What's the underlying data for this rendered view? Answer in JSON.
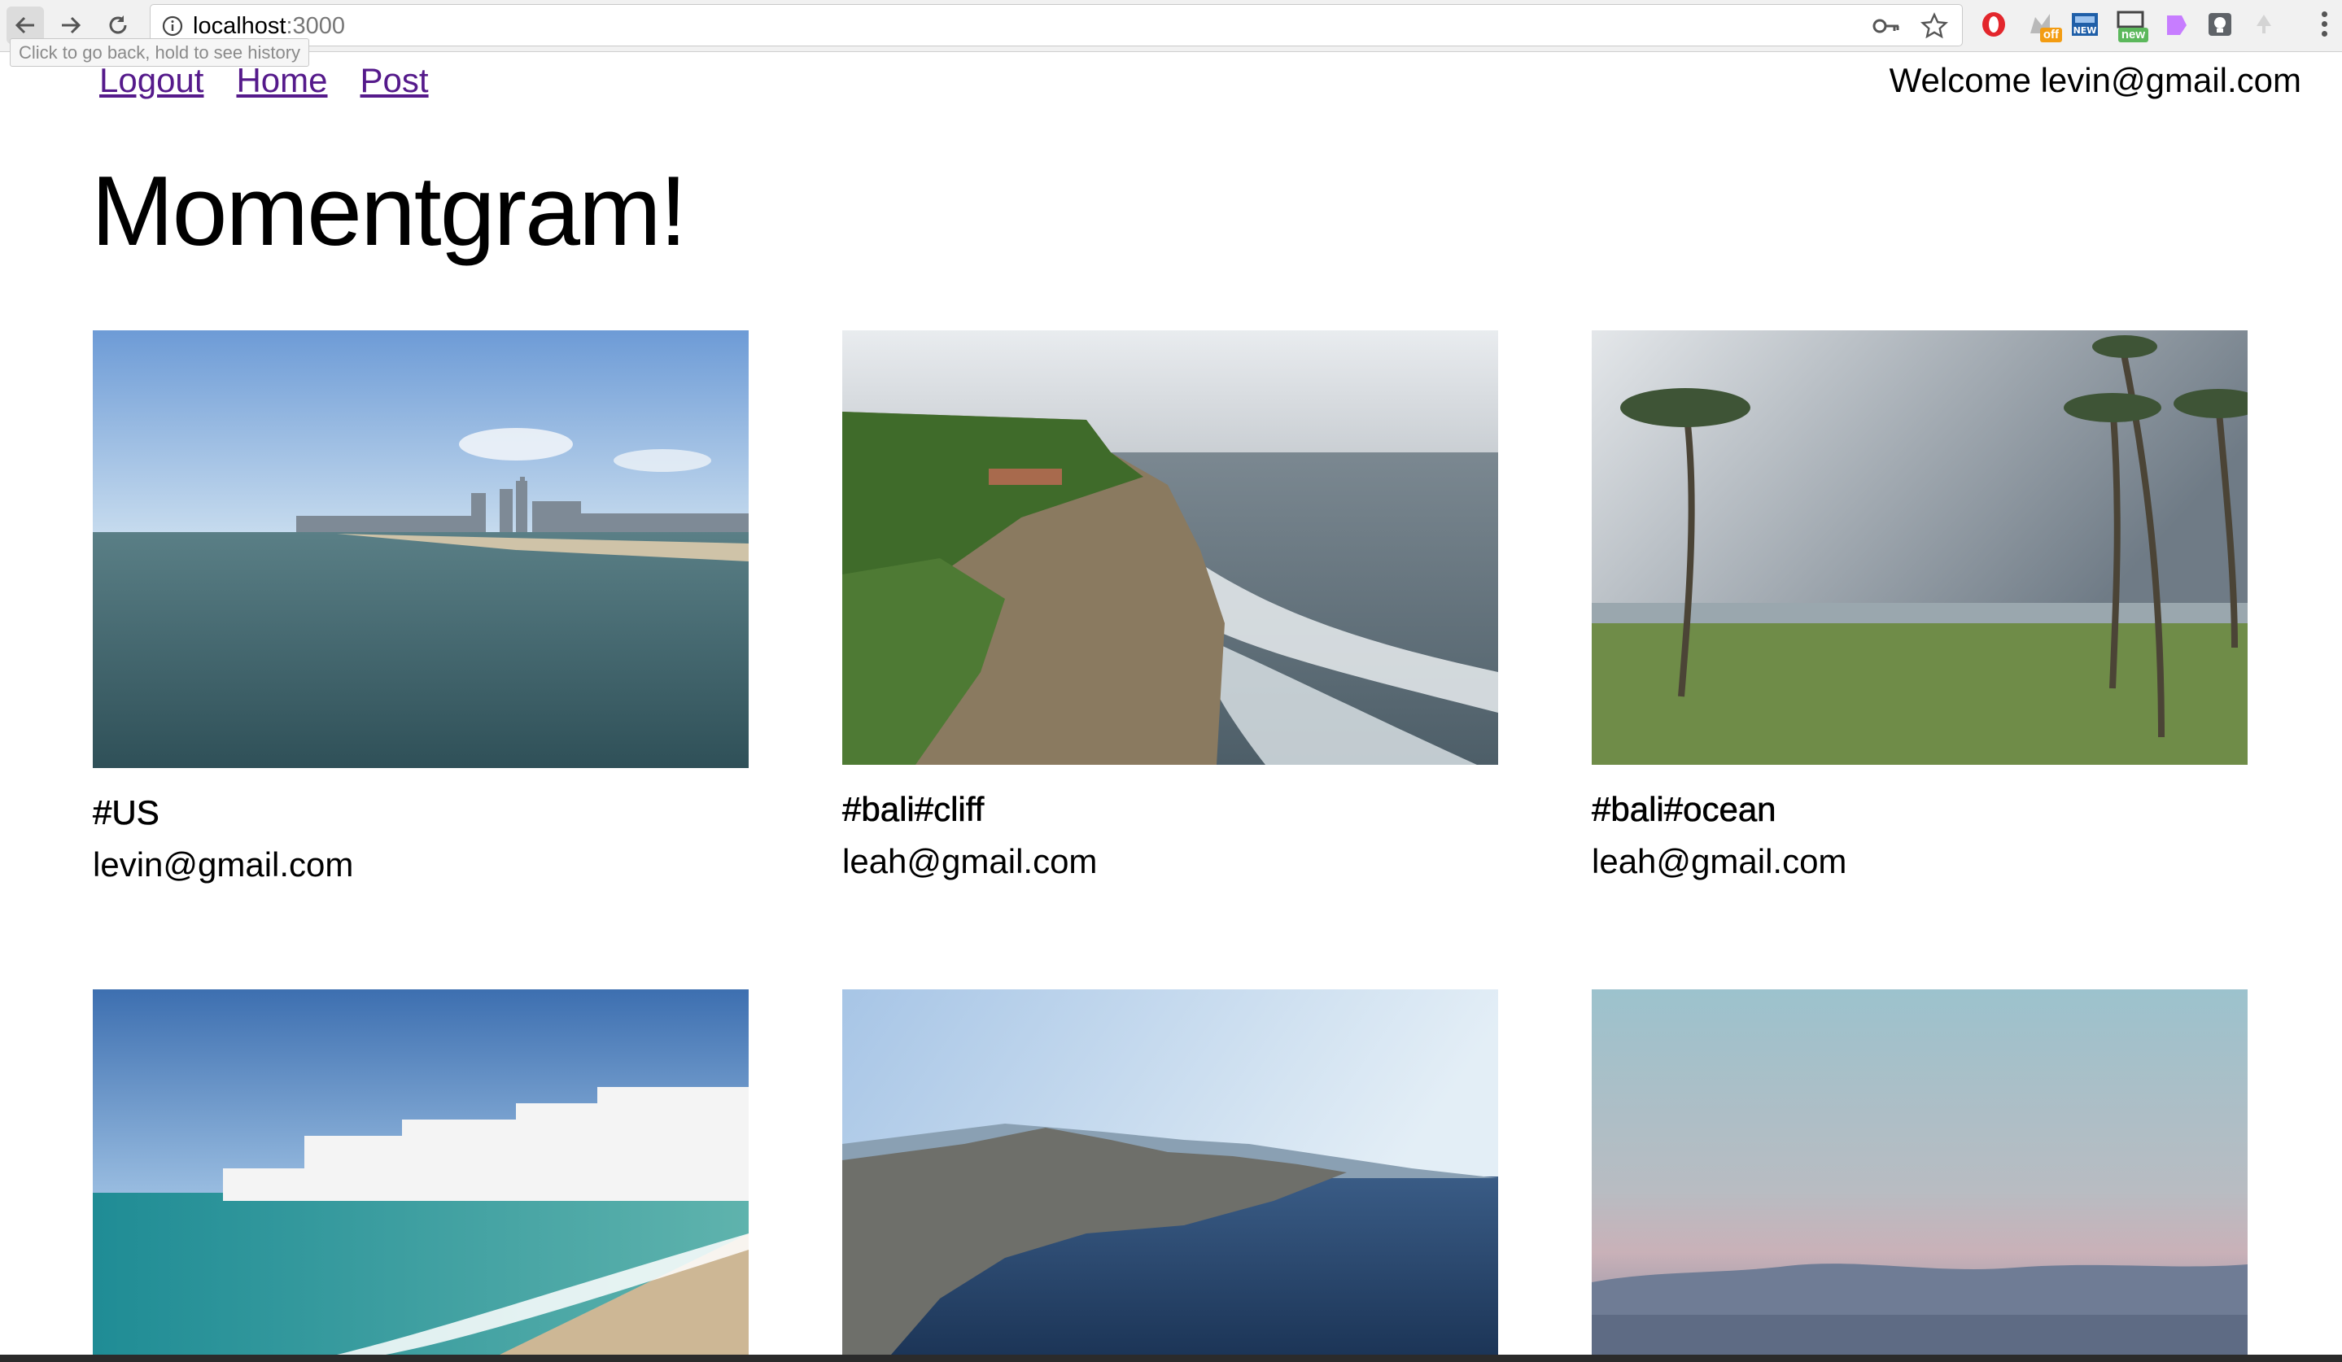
{
  "browser": {
    "url_host": "localhost",
    "url_port": ":3000",
    "back_tooltip": "Click to go back, hold to see history",
    "extensions": [
      {
        "icon": "opera-o-icon",
        "badge": ""
      },
      {
        "icon": "shopping-offer-icon",
        "badge": "off"
      },
      {
        "icon": "new-tab-icon",
        "badge": "NEW"
      },
      {
        "icon": "new-window-icon",
        "badge": "new"
      },
      {
        "icon": "paint-palette-icon",
        "badge": ""
      },
      {
        "icon": "lightbulb-icon",
        "badge": ""
      },
      {
        "icon": "tree-icon",
        "badge": ""
      }
    ]
  },
  "nav": {
    "logout": "Logout",
    "home": "Home",
    "post": "Post"
  },
  "welcome": "Welcome levin@gmail.com",
  "title": "Momentgram!",
  "posts": [
    {
      "tags": "#US",
      "author": "levin@gmail.com",
      "photo": "city-skyline-ocean-photo"
    },
    {
      "tags": "#bali#cliff",
      "author": "leah@gmail.com",
      "photo": "sea-cliff-waves-photo"
    },
    {
      "tags": "#bali#ocean",
      "author": "leah@gmail.com",
      "photo": "palm-trees-beach-photo"
    },
    {
      "tags": "",
      "author": "",
      "photo": "white-village-beach-photo"
    },
    {
      "tags": "",
      "author": "",
      "photo": "rocky-coast-sea-photo"
    },
    {
      "tags": "",
      "author": "",
      "photo": "misty-horizon-photo"
    }
  ]
}
